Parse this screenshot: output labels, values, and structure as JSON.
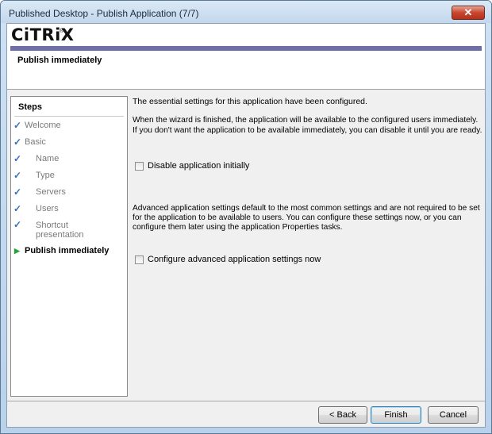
{
  "window": {
    "title": "Published Desktop - Publish Application (7/7)",
    "close_label": "✕"
  },
  "header": {
    "logo": "CiTRiX",
    "logo_mark": "®",
    "title": "Publish immediately"
  },
  "steps": {
    "title": "Steps",
    "items": [
      {
        "label": "Welcome"
      },
      {
        "label": "Basic"
      },
      {
        "label": "Name"
      },
      {
        "label": "Type"
      },
      {
        "label": "Servers"
      },
      {
        "label": "Users"
      },
      {
        "label": "Shortcut",
        "label2": "presentation"
      },
      {
        "label": "Publish immediately"
      }
    ],
    "done_mark": "✓",
    "current_mark": "▶"
  },
  "main": {
    "intro": "The essential settings for this application have been configured.",
    "info_line1": "When the wizard is finished, the application will be available to the configured users immediately.",
    "info_line2": "If you don't want the application to be available immediately, you can disable it until you are ready.",
    "disable_label": "Disable application initially",
    "advanced_line1": "Advanced application settings default to the most common settings and are not required to be set",
    "advanced_line2": "for the application to be available to users.  You can configure these settings now, or you can",
    "advanced_line3": "configure them later using the application Properties tasks.",
    "configure_label": "Configure advanced application settings now"
  },
  "footer": {
    "back": "< Back",
    "finish": "Finish",
    "cancel": "Cancel"
  }
}
